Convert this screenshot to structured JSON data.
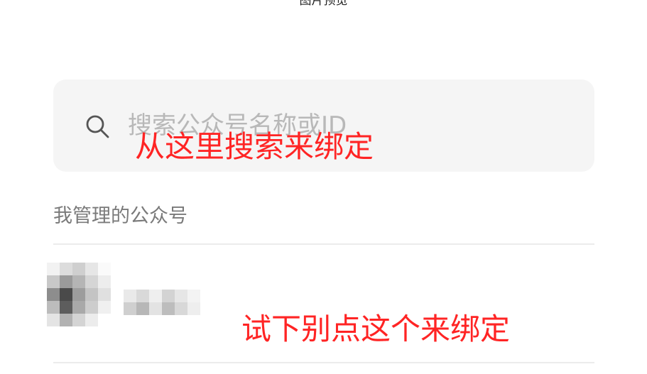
{
  "header": {
    "title": "图片预览"
  },
  "search": {
    "placeholder": "搜索公众号名称或ID"
  },
  "annotations": {
    "search_hint": "从这里搜索来绑定",
    "account_hint": "试下别点这个来绑定"
  },
  "section": {
    "managed_label": "我管理的公众号"
  },
  "managed_accounts": [
    {
      "avatar": "pixelated-avatar",
      "name": "pixelated-name"
    }
  ],
  "colors": {
    "annotation": "#ff2424",
    "search_bg": "#f5f5f5",
    "label": "#7a7a7a",
    "divider": "#ececec"
  },
  "icons": {
    "search": "search-icon"
  }
}
